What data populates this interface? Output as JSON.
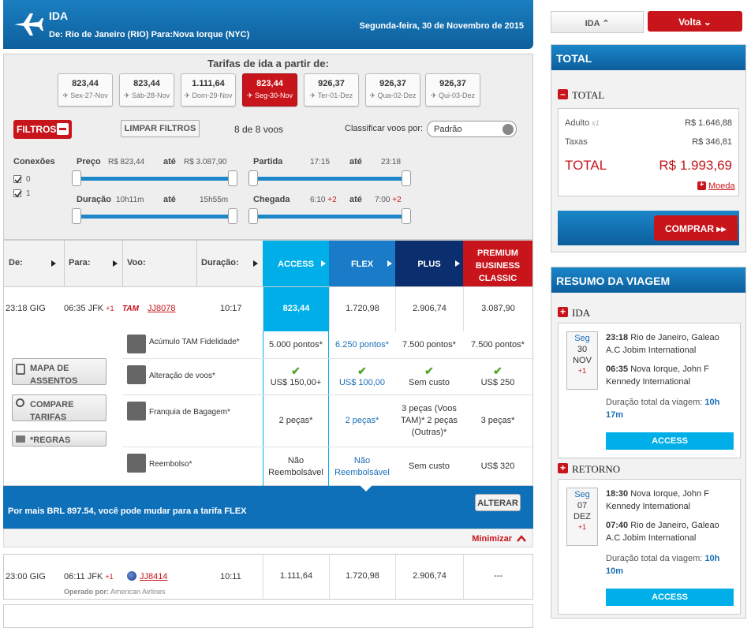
{
  "header": {
    "title": "IDA",
    "route": "De: Rio de Janeiro (RIO) Para:Nova Iorque (NYC)",
    "date": "Segunda-feira, 30 de Novembro de 2015"
  },
  "tarifas_title": "Tarifas de ida a partir de:",
  "date_cards": [
    {
      "price": "823,44",
      "day": "Sex-27-Nov"
    },
    {
      "price": "823,44",
      "day": "Sáb-28-Nov"
    },
    {
      "price": "1.111,64",
      "day": "Dom-29-Nov"
    },
    {
      "price": "823,44",
      "day": "Seg-30-Nov",
      "selected": true
    },
    {
      "price": "926,37",
      "day": "Ter-01-Dez"
    },
    {
      "price": "926,37",
      "day": "Qua-02-Dez"
    },
    {
      "price": "926,37",
      "day": "Qui-03-Dez"
    }
  ],
  "filters": {
    "filtros_label": "FILTROS",
    "limpar_label": "LIMPAR FILTROS",
    "count": "8 de 8 voos",
    "sort_label": "Classificar voos por:",
    "sort_value": "Padrão",
    "conexoes_label": "Conexões",
    "conexoes": [
      "0",
      "1"
    ],
    "preco_label": "Preço",
    "preco_min": "R$ 823,44",
    "preco_max": "R$ 3.087,90",
    "ate": "até",
    "partida_label": "Partida",
    "partida_min": "17:15",
    "partida_max": "23:18",
    "duracao_label": "Duração",
    "duracao_min": "10h11m",
    "duracao_max": "15h55m",
    "chegada_label": "Chegada",
    "chegada_min": "6:10",
    "chegada_max": "7:00",
    "plus2": "+2"
  },
  "columns": {
    "de": "De:",
    "para": "Para:",
    "voo": "Voo:",
    "duracao": "Duração:"
  },
  "fares": [
    {
      "name": "ACCESS",
      "color": "#00aee8"
    },
    {
      "name": "FLEX",
      "color": "#1a7cc8"
    },
    {
      "name": "PLUS",
      "color": "#0b2f6e"
    },
    {
      "name": "PREMIUM BUSINESS CLASSIC",
      "color": "#c8151b"
    }
  ],
  "flight1": {
    "dep": "23:18 GIG",
    "arr": "06:35 JFK",
    "plus": "+1",
    "airline": "TAM",
    "flight": "JJ8078",
    "duration": "10:17",
    "prices": [
      "823,44",
      "1.720,98",
      "2.906,74",
      "3.087,90"
    ]
  },
  "details": {
    "mapa": "MAPA DE ASSENTOS",
    "comparar": "COMPARE TARIFAS",
    "regras": "*REGRAS",
    "rows": [
      {
        "label": "Acúmulo TAM Fidelidade*",
        "values": [
          "5.000 pontos*",
          "6.250 pontos*",
          "7.500 pontos*",
          "7.500 pontos*"
        ]
      },
      {
        "label": "Alteração de voos*",
        "values": [
          "US$ 150,00+",
          "US$ 100,00",
          "Sem custo",
          "US$ 250"
        ]
      },
      {
        "label": "Franquia de Bagagem*",
        "values": [
          "2 peças*",
          "2 peças*",
          "3 peças (Voos TAM)* 2 peças (Outras)*",
          "3 peças*"
        ]
      },
      {
        "label": "Reembolso*",
        "values": [
          "Não Reembolsável",
          "Não Reembolsável",
          "Sem custo",
          "US$ 320"
        ]
      }
    ]
  },
  "banner": {
    "text": "Por mais BRL 897.54, você pode mudar para a tarifa FLEX",
    "button": "ALTERAR"
  },
  "minimizar": "Minimizar",
  "flight2": {
    "dep": "23:00 GIG",
    "arr": "06:11 JFK",
    "plus": "+1",
    "flight": "JJ8414",
    "duration": "10:11",
    "operated_label": "Operado por:",
    "operated": "American Airlines",
    "prices": [
      "1.111,64",
      "1.720,98",
      "2.906,74",
      "---"
    ]
  },
  "sidebar": {
    "ida_tab": "IDA",
    "volta_tab": "Volta",
    "total_title": "TOTAL",
    "total_sub": "TOTAL",
    "adulto": "Adulto",
    "adulto_qty": "x1",
    "adulto_val": "R$ 1.646,88",
    "taxas": "Taxas",
    "taxas_val": "R$ 346,81",
    "total_label": "TOTAL",
    "total_val": "R$ 1.993,69",
    "moeda": "Moeda",
    "comprar": "COMPRAR",
    "resumo_title": "RESUMO DA VIAGEM",
    "ida_label": "IDA",
    "ida": {
      "dow": "Seg",
      "day": "30",
      "month": "NOV",
      "plus": "+1",
      "dep_time": "23:18",
      "dep_place": "Rio de Janeiro, Galeao A.C Jobim International",
      "arr_time": "06:35",
      "arr_place": "Nova Iorque, John F Kennedy International",
      "dur_label": "Duração total da viagem:",
      "dur": "10h 17m",
      "fare": "ACCESS"
    },
    "retorno_label": "RETORNO",
    "retorno": {
      "dow": "Seg",
      "day": "07",
      "month": "DEZ",
      "plus": "+1",
      "dep_time": "18:30",
      "dep_place": "Nova Iorque, John F Kennedy International",
      "arr_time": "07:40",
      "arr_place": "Rio de Janeiro, Galeao A.C Jobim International",
      "dur_label": "Duração total da viagem:",
      "dur": "10h 10m",
      "fare": "ACCESS"
    }
  }
}
